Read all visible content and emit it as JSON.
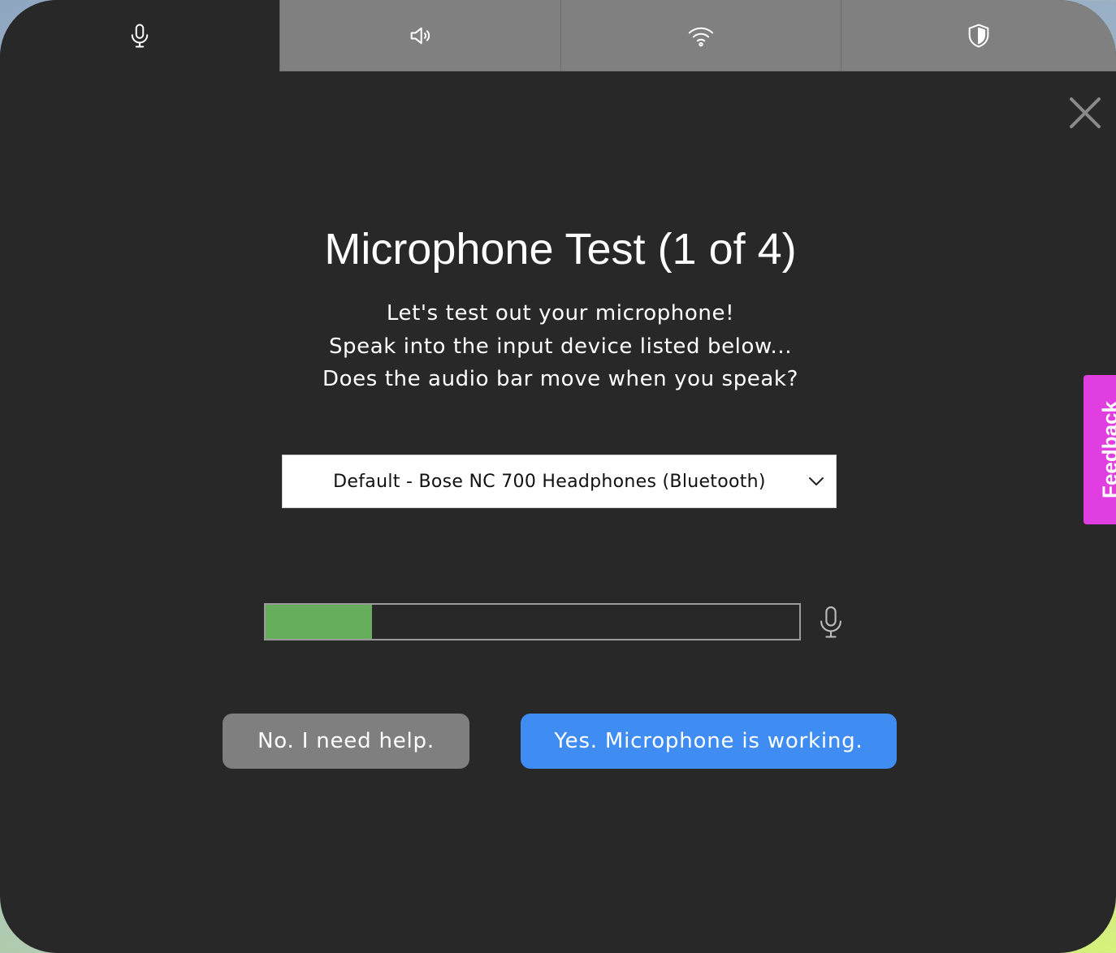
{
  "tabs": [
    {
      "icon": "microphone-icon",
      "active": true
    },
    {
      "icon": "speaker-icon",
      "active": false
    },
    {
      "icon": "wifi-icon",
      "active": false
    },
    {
      "icon": "shield-icon",
      "active": false
    }
  ],
  "dialog": {
    "title": "Microphone Test (1 of 4)",
    "instructions": [
      "Let's test out your microphone!",
      "Speak into the input device listed below...",
      "Does the audio bar move when you speak?"
    ],
    "device_select": {
      "selected": "Default - Bose NC 700 Headphones (Bluetooth)"
    },
    "audio_level_fraction": 0.2,
    "buttons": {
      "no_label": "No. I need help.",
      "yes_label": "Yes. Microphone is working."
    }
  },
  "feedback": {
    "label": "Feedback"
  },
  "colors": {
    "panel_bg": "#282828",
    "tab_inactive_bg": "#808080",
    "meter_fill": "#66ad5c",
    "yes_button": "#3f8cf3",
    "no_button": "#7f7f7f",
    "feedback_tab": "#e03ee0"
  }
}
